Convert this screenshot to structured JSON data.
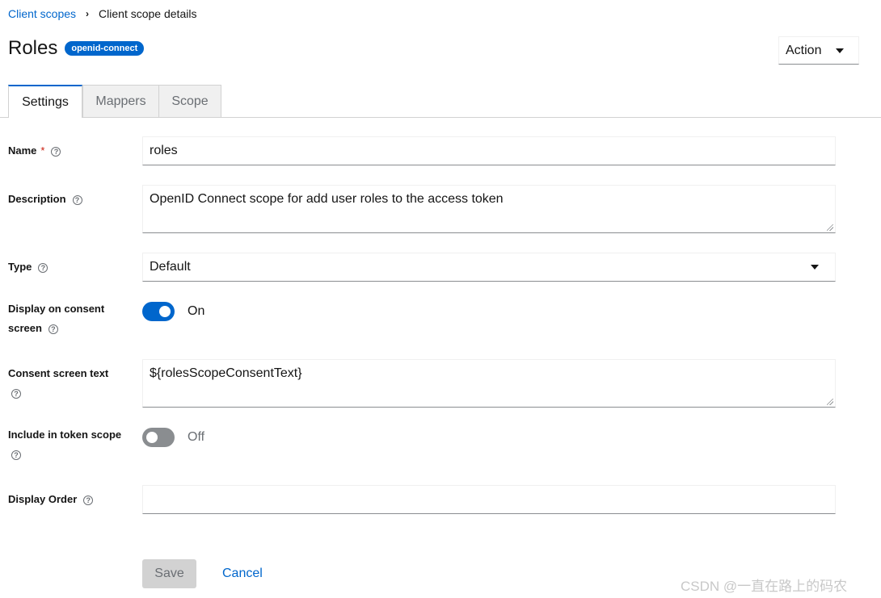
{
  "breadcrumb": {
    "parent": "Client scopes",
    "current": "Client scope details"
  },
  "header": {
    "title": "Roles",
    "badge": "openid-connect",
    "action_label": "Action"
  },
  "tabs": [
    {
      "label": "Settings",
      "active": true
    },
    {
      "label": "Mappers",
      "active": false
    },
    {
      "label": "Scope",
      "active": false
    }
  ],
  "form": {
    "name": {
      "label": "Name",
      "required_mark": "*",
      "value": "roles"
    },
    "description": {
      "label": "Description",
      "value": "OpenID Connect scope for add user roles to the access token"
    },
    "type": {
      "label": "Type",
      "value": "Default"
    },
    "display_on_consent": {
      "label_line1": "Display on consent",
      "label_line2": "screen",
      "state": "On",
      "checked": true
    },
    "consent_text": {
      "label": "Consent screen text",
      "value": "${rolesScopeConsentText}"
    },
    "include_token_scope": {
      "label": "Include in token scope",
      "state": "Off",
      "checked": false
    },
    "display_order": {
      "label": "Display Order",
      "value": ""
    }
  },
  "buttons": {
    "save": "Save",
    "cancel": "Cancel"
  },
  "help_glyph": "?",
  "watermark": "CSDN @一直在路上的码农",
  "colors": {
    "accent": "#0066cc",
    "required": "#c9190b"
  }
}
